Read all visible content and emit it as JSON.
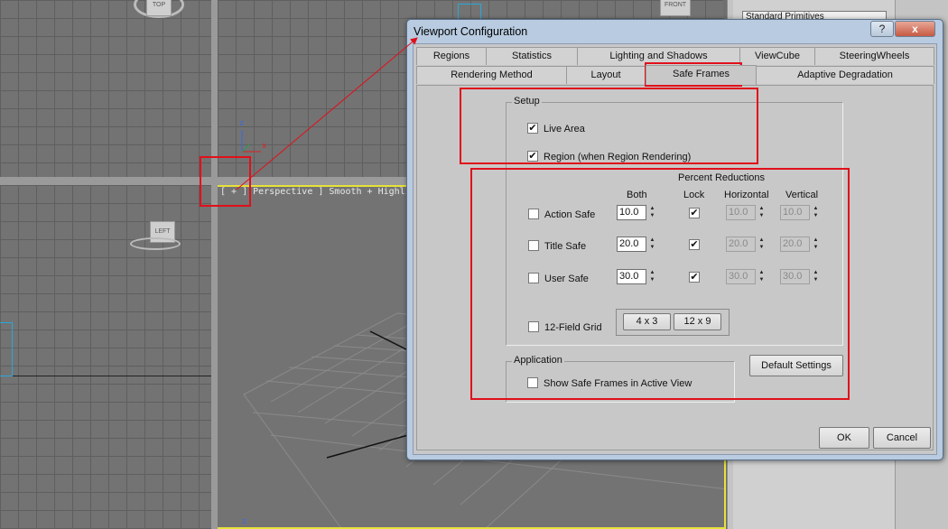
{
  "dialog": {
    "title": "Viewport Configuration",
    "help_label": "?",
    "close_label": "x",
    "tabs_row1": [
      {
        "label": "Regions"
      },
      {
        "label": "Statistics"
      },
      {
        "label": "Lighting and Shadows"
      },
      {
        "label": "ViewCube"
      },
      {
        "label": "SteeringWheels"
      }
    ],
    "tabs_row2": [
      {
        "label": "Rendering Method"
      },
      {
        "label": "Layout"
      },
      {
        "label": "Safe Frames",
        "active": true
      },
      {
        "label": "Adaptive Degradation"
      }
    ],
    "setup": {
      "title": "Setup",
      "live_area": {
        "label": "Live Area",
        "checked": true
      },
      "region": {
        "label": "Region (when Region Rendering)",
        "checked": true
      }
    },
    "reductions": {
      "title": "Percent Reductions",
      "col_both": "Both",
      "col_lock": "Lock",
      "col_horizontal": "Horizontal",
      "col_vertical": "Vertical",
      "rows": [
        {
          "label": "Action Safe",
          "checked": false,
          "both": "10.0",
          "lock": true,
          "horizontal": "10.0",
          "vertical": "10.0"
        },
        {
          "label": "Title Safe",
          "checked": false,
          "both": "20.0",
          "lock": true,
          "horizontal": "20.0",
          "vertical": "20.0"
        },
        {
          "label": "User Safe",
          "checked": false,
          "both": "30.0",
          "lock": true,
          "horizontal": "30.0",
          "vertical": "30.0"
        }
      ],
      "grid_label": "12-Field Grid",
      "grid_checked": false,
      "grid_4x3": "4 x 3",
      "grid_12x9": "12 x 9"
    },
    "application": {
      "title": "Application",
      "show_label": "Show Safe Frames in Active View",
      "show_checked": false
    },
    "default_settings": "Default Settings",
    "ok": "OK",
    "cancel": "Cancel"
  },
  "viewports": {
    "perspective_label": "[ + ] Perspective ] Smooth + Highli",
    "top_cube": "TOP",
    "front_cube": "FRONT",
    "left_cube": "LEFT",
    "axis_x": "x",
    "axis_z": "z",
    "axis_z2": "z"
  },
  "command_panel": {
    "dropdown": "Standard Primitives"
  },
  "colors": {
    "highlight_red": "#e0101a",
    "active_viewport": "#e6e23a"
  }
}
